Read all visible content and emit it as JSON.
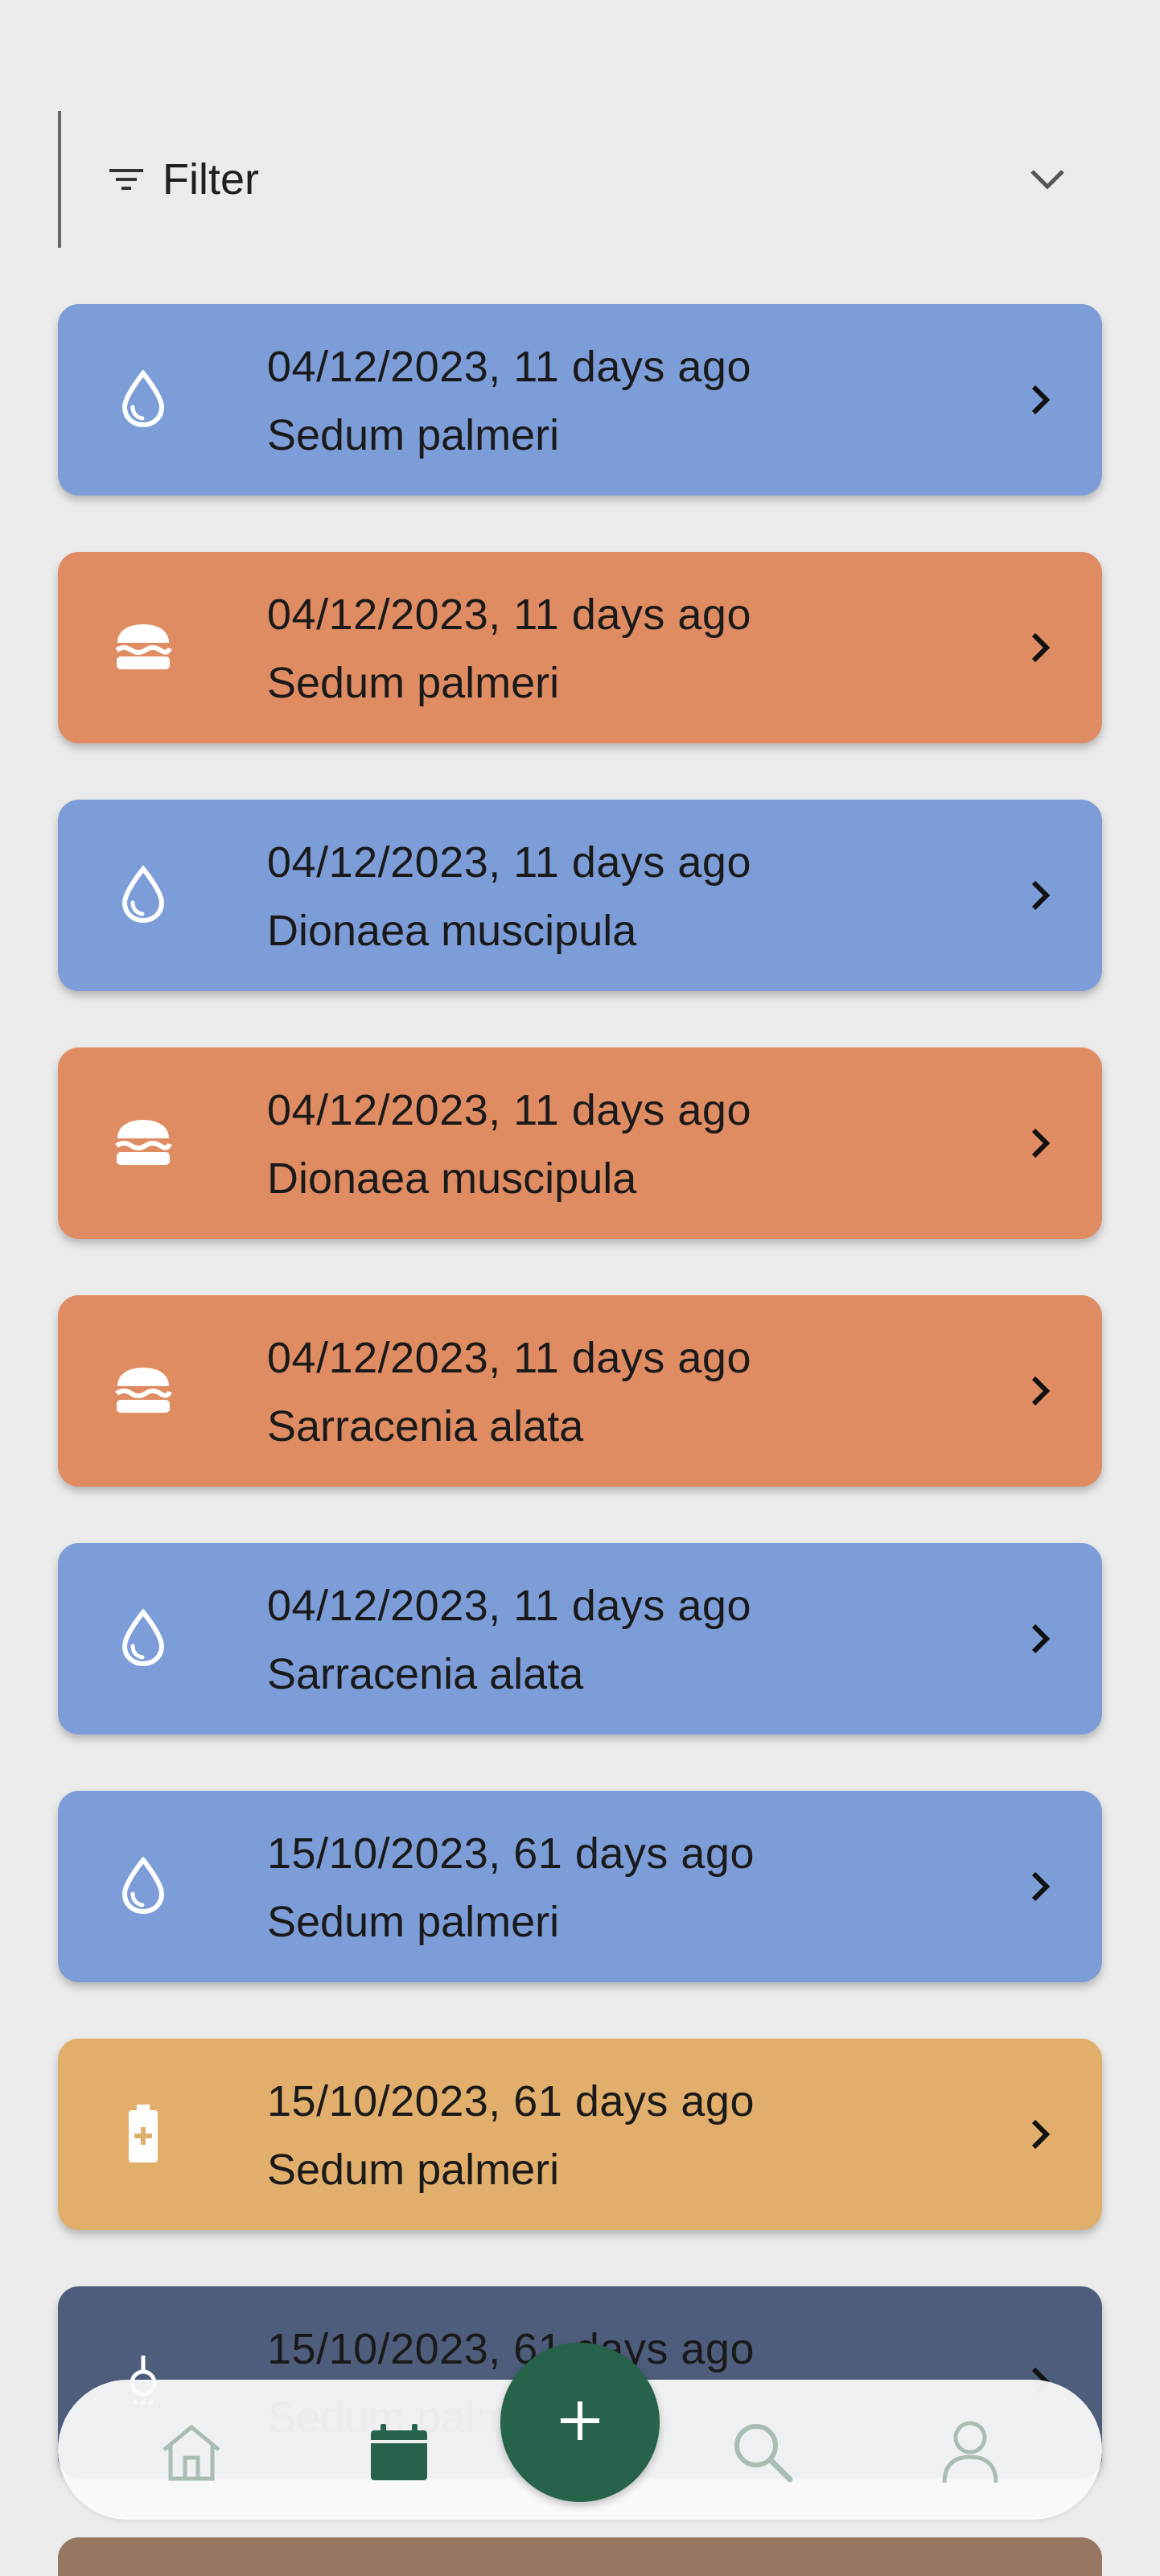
{
  "filter": {
    "label": "Filter",
    "icon": "filter-lines-icon",
    "chevron_icon": "chevron-down-icon"
  },
  "colors": {
    "water": "#7d9dd8",
    "feed": "#e08c62",
    "fertilize": "#e2ae6c",
    "repot": "#4e5d7b",
    "peek": "#967862",
    "fab": "#27624a",
    "nav_icon": "#a9bdb3",
    "nav_active": "#27624a"
  },
  "logs": [
    {
      "type": "water",
      "icon": "water-drop-icon",
      "date": "04/12/2023, 11 days ago",
      "plant": "Sedum palmeri"
    },
    {
      "type": "feed",
      "icon": "burger-icon",
      "date": "04/12/2023, 11 days ago",
      "plant": "Sedum palmeri"
    },
    {
      "type": "water",
      "icon": "water-drop-icon",
      "date": "04/12/2023, 11 days ago",
      "plant": "Dionaea muscipula"
    },
    {
      "type": "feed",
      "icon": "burger-icon",
      "date": "04/12/2023, 11 days ago",
      "plant": "Dionaea muscipula"
    },
    {
      "type": "feed",
      "icon": "burger-icon",
      "date": "04/12/2023, 11 days ago",
      "plant": "Sarracenia alata"
    },
    {
      "type": "water",
      "icon": "water-drop-icon",
      "date": "04/12/2023, 11 days ago",
      "plant": "Sarracenia alata"
    },
    {
      "type": "water",
      "icon": "water-drop-icon",
      "date": "15/10/2023, 61 days ago",
      "plant": "Sedum palmeri"
    },
    {
      "type": "fertilize",
      "icon": "battery-plus-icon",
      "date": "15/10/2023, 61 days ago",
      "plant": "Sedum palmeri"
    },
    {
      "type": "repot",
      "icon": "pot-icon",
      "date": "15/10/2023, 61 days ago",
      "plant": "Sedum palmeri"
    }
  ],
  "nav": {
    "items": [
      {
        "id": "home",
        "icon": "home-icon"
      },
      {
        "id": "calendar",
        "icon": "calendar-icon",
        "active": true
      },
      {
        "id": "search",
        "icon": "search-icon"
      },
      {
        "id": "profile",
        "icon": "profile-icon"
      }
    ],
    "fab_icon": "plus-icon"
  }
}
